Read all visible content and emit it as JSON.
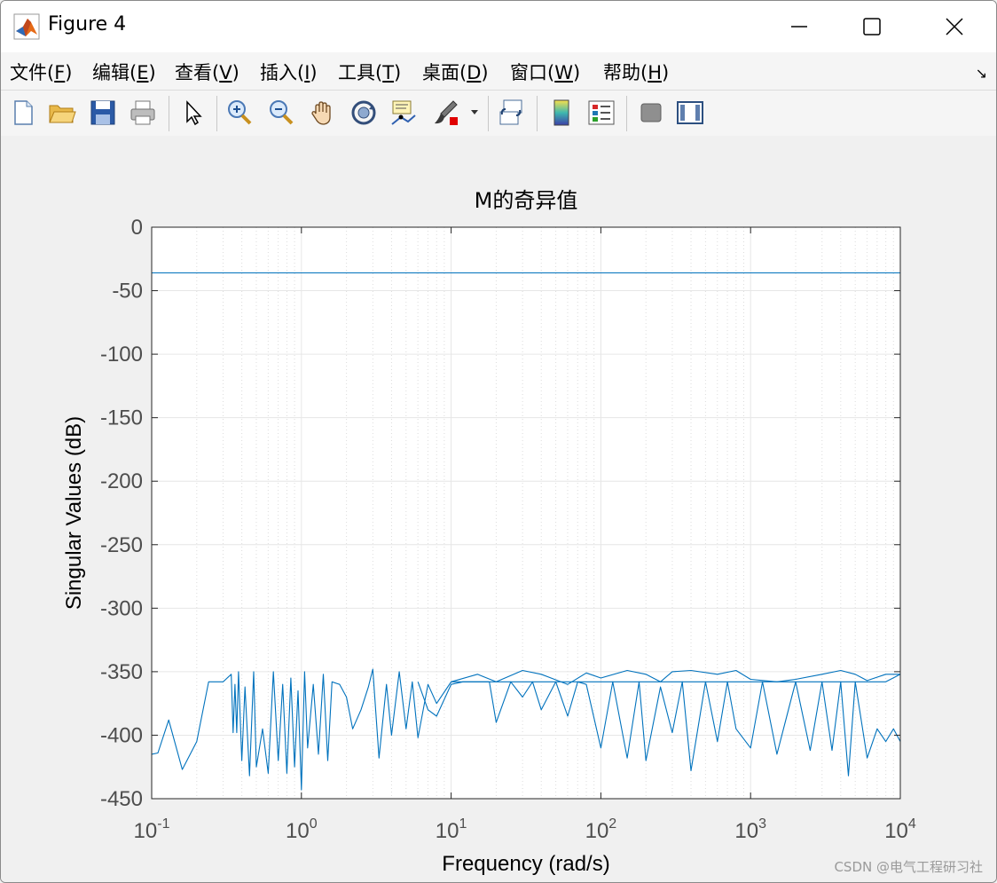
{
  "window": {
    "title": "Figure 4",
    "menu": [
      {
        "label": "文件(",
        "key": "F",
        "end": ")"
      },
      {
        "label": "编辑(",
        "key": "E",
        "end": ")"
      },
      {
        "label": "查看(",
        "key": "V",
        "end": ")"
      },
      {
        "label": "插入(",
        "key": "I",
        "end": ")"
      },
      {
        "label": "工具(",
        "key": "T",
        "end": ")"
      },
      {
        "label": "桌面(",
        "key": "D",
        "end": ")"
      },
      {
        "label": "窗口(",
        "key": "W",
        "end": ")"
      },
      {
        "label": "帮助(",
        "key": "H",
        "end": ")"
      }
    ],
    "toolbar_icons": [
      "new-figure-icon",
      "open-file-icon",
      "save-icon",
      "print-icon",
      "select-arrow-icon",
      "zoom-in-icon",
      "zoom-out-icon",
      "pan-hand-icon",
      "rotate-3d-icon",
      "data-cursor-icon",
      "brush-icon",
      "link-plot-icon",
      "colorbar-icon",
      "legend-icon",
      "hide-plot-tools-icon",
      "show-plot-tools-icon"
    ],
    "watermark": "CSDN @电气工程研习社"
  },
  "colors": {
    "series": "#0072bd",
    "grid": "#e6e6e6",
    "axis": "#262626",
    "tick_label": "#4d4d4d"
  },
  "chart_data": {
    "type": "line",
    "title": "M的奇异值",
    "xlabel": "Frequency (rad/s)",
    "ylabel": "Singular Values (dB)",
    "xscale": "log",
    "xlim": [
      0.1,
      10000
    ],
    "ylim": [
      -450,
      0
    ],
    "xticks": [
      0.1,
      1,
      10,
      100,
      1000,
      10000
    ],
    "xtick_labels": [
      {
        "base": "10",
        "exp": "-1"
      },
      {
        "base": "10",
        "exp": "0"
      },
      {
        "base": "10",
        "exp": "1"
      },
      {
        "base": "10",
        "exp": "2"
      },
      {
        "base": "10",
        "exp": "3"
      },
      {
        "base": "10",
        "exp": "4"
      }
    ],
    "yticks": [
      0,
      -50,
      -100,
      -150,
      -200,
      -250,
      -300,
      -350,
      -400,
      -450
    ],
    "grid": true,
    "series": [
      {
        "x": [
          0.1,
          10000
        ],
        "y": [
          -36,
          -36
        ]
      },
      {
        "x": [
          0.1,
          0.11,
          0.13,
          0.16,
          0.2,
          0.24,
          0.3,
          0.34,
          0.35,
          0.36,
          0.37,
          0.38,
          0.4,
          0.42,
          0.45,
          0.48,
          0.5,
          0.55,
          0.6,
          0.65,
          0.7,
          0.75,
          0.8,
          0.85,
          0.9,
          0.95,
          1.0,
          1.05,
          1.1,
          1.2,
          1.3,
          1.4,
          1.5,
          1.6,
          1.8,
          2.0,
          2.2,
          2.5,
          2.8,
          3.0,
          3.3,
          3.7,
          4.0,
          4.5,
          5.0,
          5.5,
          6.0,
          7.0,
          8.0,
          10,
          12,
          15,
          20,
          25,
          30,
          40,
          50,
          60,
          80,
          100,
          120,
          150,
          200,
          250,
          300,
          400,
          500,
          600,
          800,
          1000,
          1200,
          1500,
          2000,
          2500,
          3000,
          4000,
          5000,
          6000,
          7000,
          8000,
          10000
        ],
        "y": [
          -415,
          -414,
          -388,
          -427,
          -405,
          -358,
          -358,
          -352,
          -398,
          -360,
          -398,
          -350,
          -420,
          -362,
          -432,
          -350,
          -425,
          -395,
          -430,
          -350,
          -420,
          -360,
          -430,
          -355,
          -425,
          -365,
          -443,
          -350,
          -410,
          -360,
          -415,
          -352,
          -420,
          -358,
          -360,
          -370,
          -395,
          -380,
          -362,
          -348,
          -418,
          -360,
          -400,
          -350,
          -395,
          -358,
          -402,
          -360,
          -375,
          -358,
          -358,
          -358,
          -358,
          -358,
          -358,
          -358,
          -358,
          -358,
          -358,
          -358,
          -358,
          -358,
          -358,
          -358,
          -358,
          -358,
          -358,
          -358,
          -358,
          -358,
          -358,
          -358,
          -358,
          -358,
          -358,
          -358,
          -358,
          -358,
          -358,
          -358,
          -352
        ]
      },
      {
        "x": [
          6.0,
          7.0,
          8.0,
          10,
          12,
          15,
          18,
          20,
          25,
          30,
          35,
          40,
          50,
          60,
          70,
          80,
          100,
          120,
          150,
          180,
          200,
          250,
          300,
          350,
          400,
          500,
          600,
          700,
          800,
          1000,
          1200,
          1500,
          2000,
          2500,
          3000,
          3500,
          4000,
          4500,
          5000,
          6000,
          7000,
          8000,
          9000,
          10000
        ],
        "y": [
          -358,
          -380,
          -385,
          -360,
          -358,
          -358,
          -358,
          -390,
          -358,
          -370,
          -358,
          -380,
          -358,
          -385,
          -358,
          -360,
          -410,
          -358,
          -418,
          -358,
          -420,
          -362,
          -398,
          -358,
          -428,
          -358,
          -405,
          -358,
          -395,
          -410,
          -358,
          -415,
          -358,
          -412,
          -358,
          -412,
          -358,
          -432,
          -358,
          -418,
          -395,
          -405,
          -395,
          -405
        ]
      },
      {
        "x": [
          10,
          15,
          20,
          30,
          40,
          60,
          80,
          100,
          150,
          200,
          250,
          300,
          400,
          600,
          800,
          1000,
          1500,
          2000,
          3000,
          4000,
          5000,
          6000,
          8000,
          10000
        ],
        "y": [
          -358,
          -352,
          -358,
          -349,
          -352,
          -360,
          -351,
          -355,
          -349,
          -352,
          -358,
          -350,
          -349,
          -352,
          -349,
          -356,
          -358,
          -356,
          -352,
          -349,
          -352,
          -357,
          -352,
          -352
        ]
      }
    ]
  }
}
